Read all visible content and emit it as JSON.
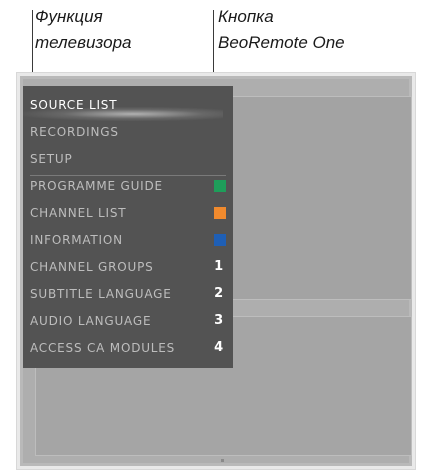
{
  "captions": {
    "left": "Функция\nтелевизора",
    "right": "Кнопка\nBeoRemote One"
  },
  "menu": {
    "items": [
      {
        "label": "SOURCE LIST",
        "active": true
      },
      {
        "label": "RECORDINGS"
      },
      {
        "label": "SETUP"
      },
      {
        "label": "PROGRAMME GUIDE",
        "key_color": "#1e9e5a",
        "key_name": "green-key-icon"
      },
      {
        "label": "CHANNEL LIST",
        "key_color": "#f08a2e",
        "key_name": "orange-key-icon"
      },
      {
        "label": "INFORMATION",
        "key_color": "#1f5fb5",
        "key_name": "blue-key-icon"
      },
      {
        "label": "CHANNEL GROUPS",
        "key_number": "1"
      },
      {
        "label": "SUBTITLE LANGUAGE",
        "key_number": "2"
      },
      {
        "label": "AUDIO LANGUAGE",
        "key_number": "3"
      },
      {
        "label": "ACCESS CA MODULES",
        "key_number": "4"
      }
    ]
  }
}
